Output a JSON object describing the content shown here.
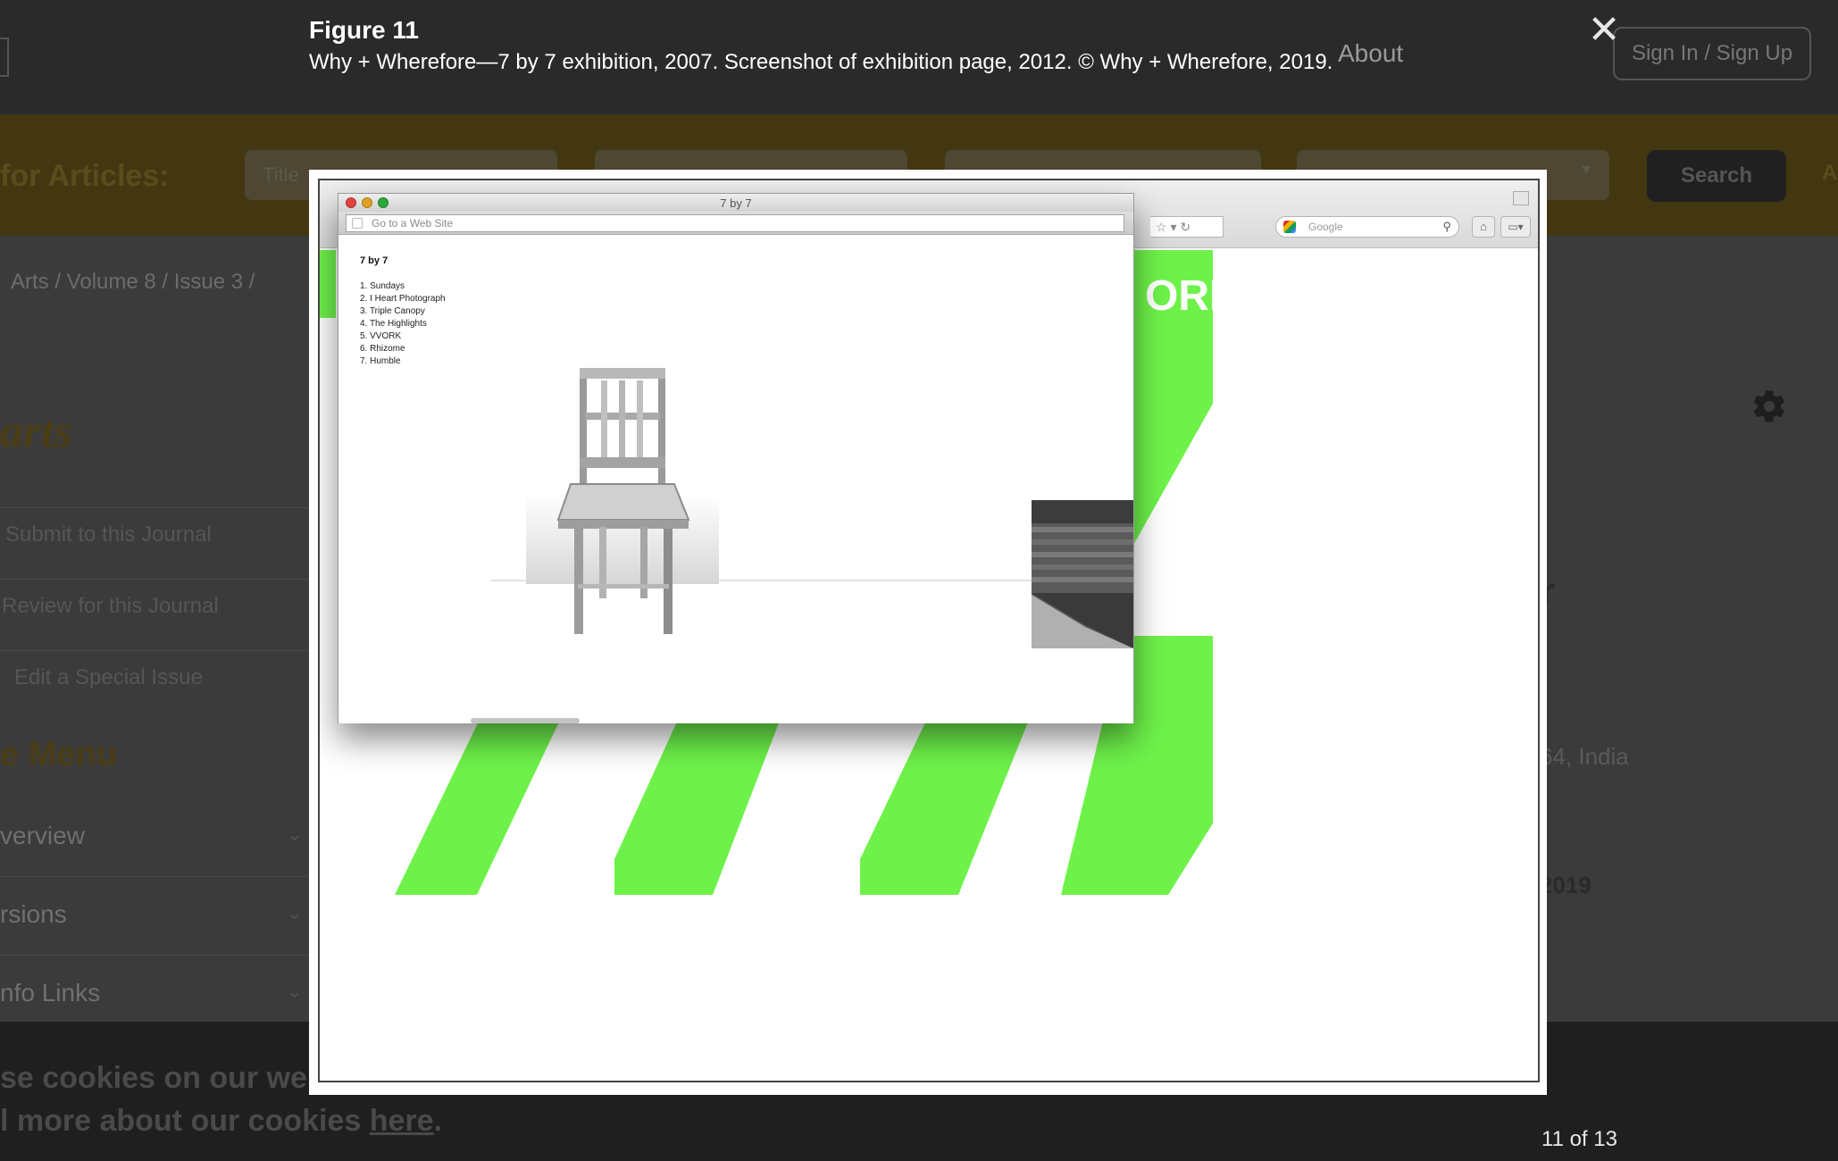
{
  "lightbox": {
    "figure_title": "Figure 11",
    "caption": "Why + Wherefore—7 by 7 exhibition, 2007. Screenshot of exhibition page, 2012. © Why + Wherefore, 2019.",
    "counter": "11 of 13",
    "close_icon": "close-icon"
  },
  "background_page": {
    "top_nav": {
      "items": [
        "About"
      ],
      "sign_in": "Sign In / Sign Up"
    },
    "search": {
      "label": "for Articles:",
      "field_placeholder": "Title",
      "button": "Search",
      "extra": "A"
    },
    "breadcrumb": "Arts  /  Volume 8  /  Issue 3  /",
    "journal_title": "arts",
    "side_links": [
      "Submit to this Journal",
      "Review for this Journal",
      "Edit a Special Issue"
    ],
    "menu_heading": "e Menu",
    "menu_items": [
      "verview",
      "rsions",
      "nfo Links"
    ],
    "right_fragments": {
      "letter": "r",
      "address": "64, India",
      "year": "2019"
    },
    "cookie": {
      "line1": "se cookies on our web",
      "line2_prefix": "l more about our cookies ",
      "line2_link": "here",
      "line2_suffix": "."
    }
  },
  "screenshot": {
    "under_browser": {
      "search_engine_placeholder": "Google",
      "banner_text": "ORE",
      "accent_green": "#6ef24a"
    },
    "popup_window": {
      "title": "7 by 7",
      "url_placeholder": "Go to a Web Site",
      "site_title": "7 by 7",
      "list": [
        "1. Sundays",
        "2. I Heart Photograph",
        "3. Triple Canopy",
        "4. The Highlights",
        "5. VVORK",
        "6. Rhizome",
        "7. Humble"
      ]
    }
  }
}
